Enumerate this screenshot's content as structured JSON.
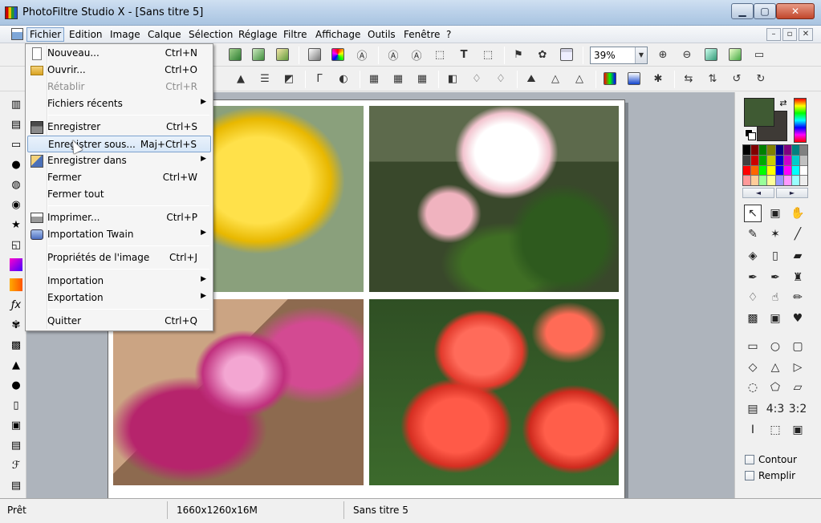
{
  "window": {
    "title": "PhotoFiltre Studio X - [Sans titre 5]",
    "min_label": "▁",
    "max_label": "▢",
    "close_label": "✕"
  },
  "menubar": {
    "items": [
      "Fichier",
      "Edition",
      "Image",
      "Calque",
      "Sélection",
      "Réglage",
      "Filtre",
      "Affichage",
      "Outils",
      "Fenêtre",
      "?"
    ],
    "mdi": [
      "–",
      "▫",
      "✕"
    ]
  },
  "toolbar": {
    "zoom_value": "39%"
  },
  "file_menu": {
    "items": [
      {
        "label": "Nouveau...",
        "shortcut": "Ctrl+N",
        "icon": "new-document-icon"
      },
      {
        "label": "Ouvrir...",
        "shortcut": "Ctrl+O",
        "icon": "open-folder-icon"
      },
      {
        "label": "Rétablir",
        "shortcut": "Ctrl+R",
        "disabled": true
      },
      {
        "label": "Fichiers récents",
        "submenu": true
      },
      {
        "label": "Enregistrer",
        "shortcut": "Ctrl+S",
        "icon": "save-disk-icon"
      },
      {
        "label": "Enregistrer sous...",
        "shortcut": "Maj+Ctrl+S",
        "highlighted": true
      },
      {
        "label": "Enregistrer dans",
        "submenu": true,
        "icon": "save-to-icon"
      },
      {
        "label": "Fermer",
        "shortcut": "Ctrl+W"
      },
      {
        "label": "Fermer tout"
      },
      {
        "label": "Imprimer...",
        "shortcut": "Ctrl+P",
        "icon": "printer-icon"
      },
      {
        "label": "Importation Twain",
        "submenu": true,
        "icon": "scanner-icon"
      },
      {
        "label": "Propriétés de l'image",
        "shortcut": "Ctrl+J"
      },
      {
        "label": "Importation",
        "submenu": true
      },
      {
        "label": "Exportation",
        "submenu": true
      },
      {
        "label": "Quitter",
        "shortcut": "Ctrl+Q"
      }
    ]
  },
  "colors": {
    "foreground": "#3f5a33",
    "background": "#3e3a36",
    "accent_highlight": "#7da2ce"
  },
  "options": {
    "contour_label": "Contour",
    "remplir_label": "Remplir"
  },
  "status": {
    "state": "Prêt",
    "dimensions": "1660x1260x16M",
    "document": "Sans titre 5"
  }
}
